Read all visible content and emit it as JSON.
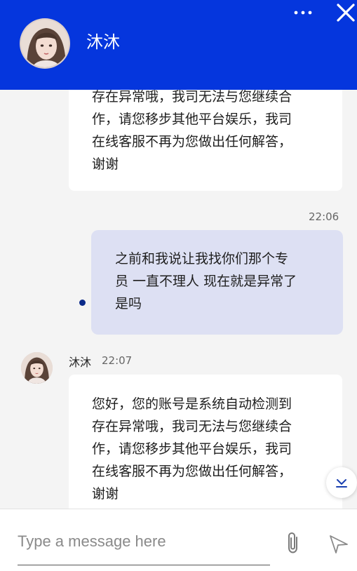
{
  "header": {
    "agent_name": "沐沐"
  },
  "messages": [
    {
      "sender": "agent",
      "lines": [
        "存在异常哦，我司无法与您继续合",
        "作，请您移步其他平台娱乐，我司",
        "在线客服不再为您做出任何解答，",
        "谢谢"
      ]
    },
    {
      "sender": "user",
      "time": "22:06",
      "lines": [
        "之前和我说让我找你们那个专",
        "员 一直不理人 现在就是异常了",
        "是吗"
      ]
    },
    {
      "sender": "agent",
      "name": "沐沐",
      "time": "22:07",
      "lines": [
        "您好，您的账号是系统自动检测到",
        "存在异常哦，我司无法与您继续合",
        "作，请您移步其他平台娱乐，我司",
        "在线客服不再为您做出任何解答，",
        "谢谢"
      ]
    }
  ],
  "composer": {
    "placeholder": "Type a message here"
  },
  "colors": {
    "header_bg": "#0536dd",
    "user_bubble": "#dde0f3",
    "agent_bubble": "#ffffff",
    "chat_bg": "#f4f4f4"
  },
  "icons": [
    "more-icon",
    "close-icon",
    "scroll-down-icon",
    "attach-icon",
    "send-icon"
  ]
}
